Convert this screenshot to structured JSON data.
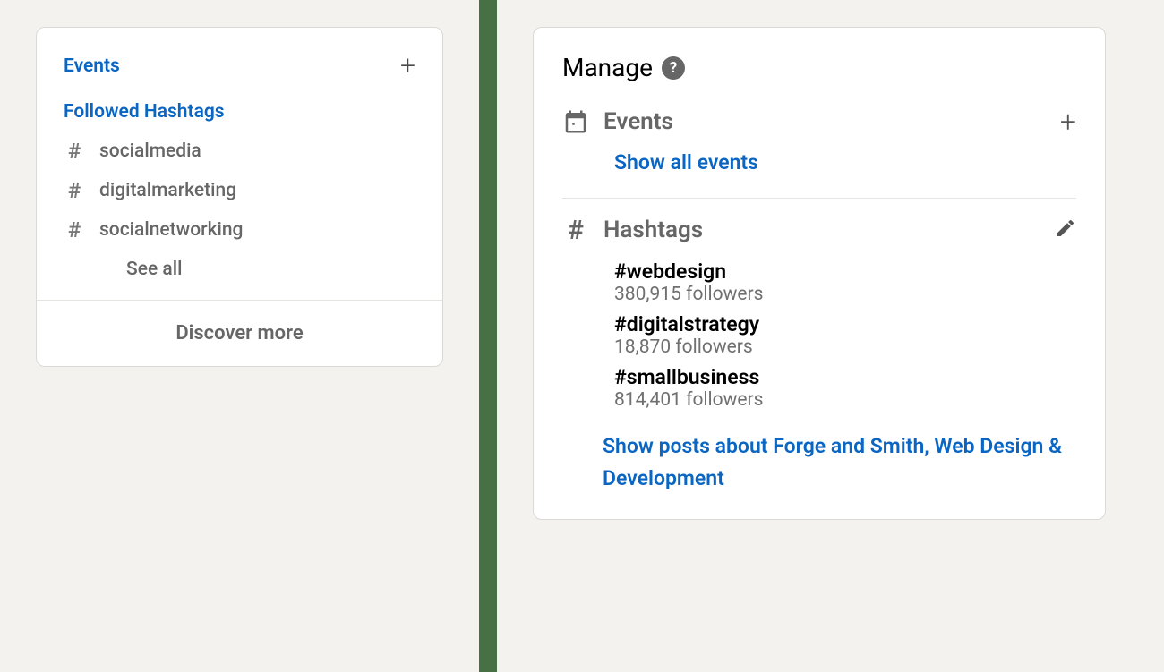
{
  "sidebar_a": {
    "events_label": "Events",
    "followed_label": "Followed Hashtags",
    "hashtags": [
      {
        "name": "socialmedia"
      },
      {
        "name": "digitalmarketing"
      },
      {
        "name": "socialnetworking"
      }
    ],
    "see_all_label": "See all",
    "discover_more_label": "Discover more"
  },
  "sidebar_b": {
    "manage_title": "Manage",
    "events_label": "Events",
    "show_all_events_label": "Show all events",
    "hashtags_label": "Hashtags",
    "hashtags": [
      {
        "tag": "#webdesign",
        "followers": "380,915 followers"
      },
      {
        "tag": "#digitalstrategy",
        "followers": "18,870 followers"
      },
      {
        "tag": "#smallbusiness",
        "followers": "814,401 followers"
      }
    ],
    "show_posts_label": "Show posts about Forge and Smith, Web Design & Development"
  }
}
